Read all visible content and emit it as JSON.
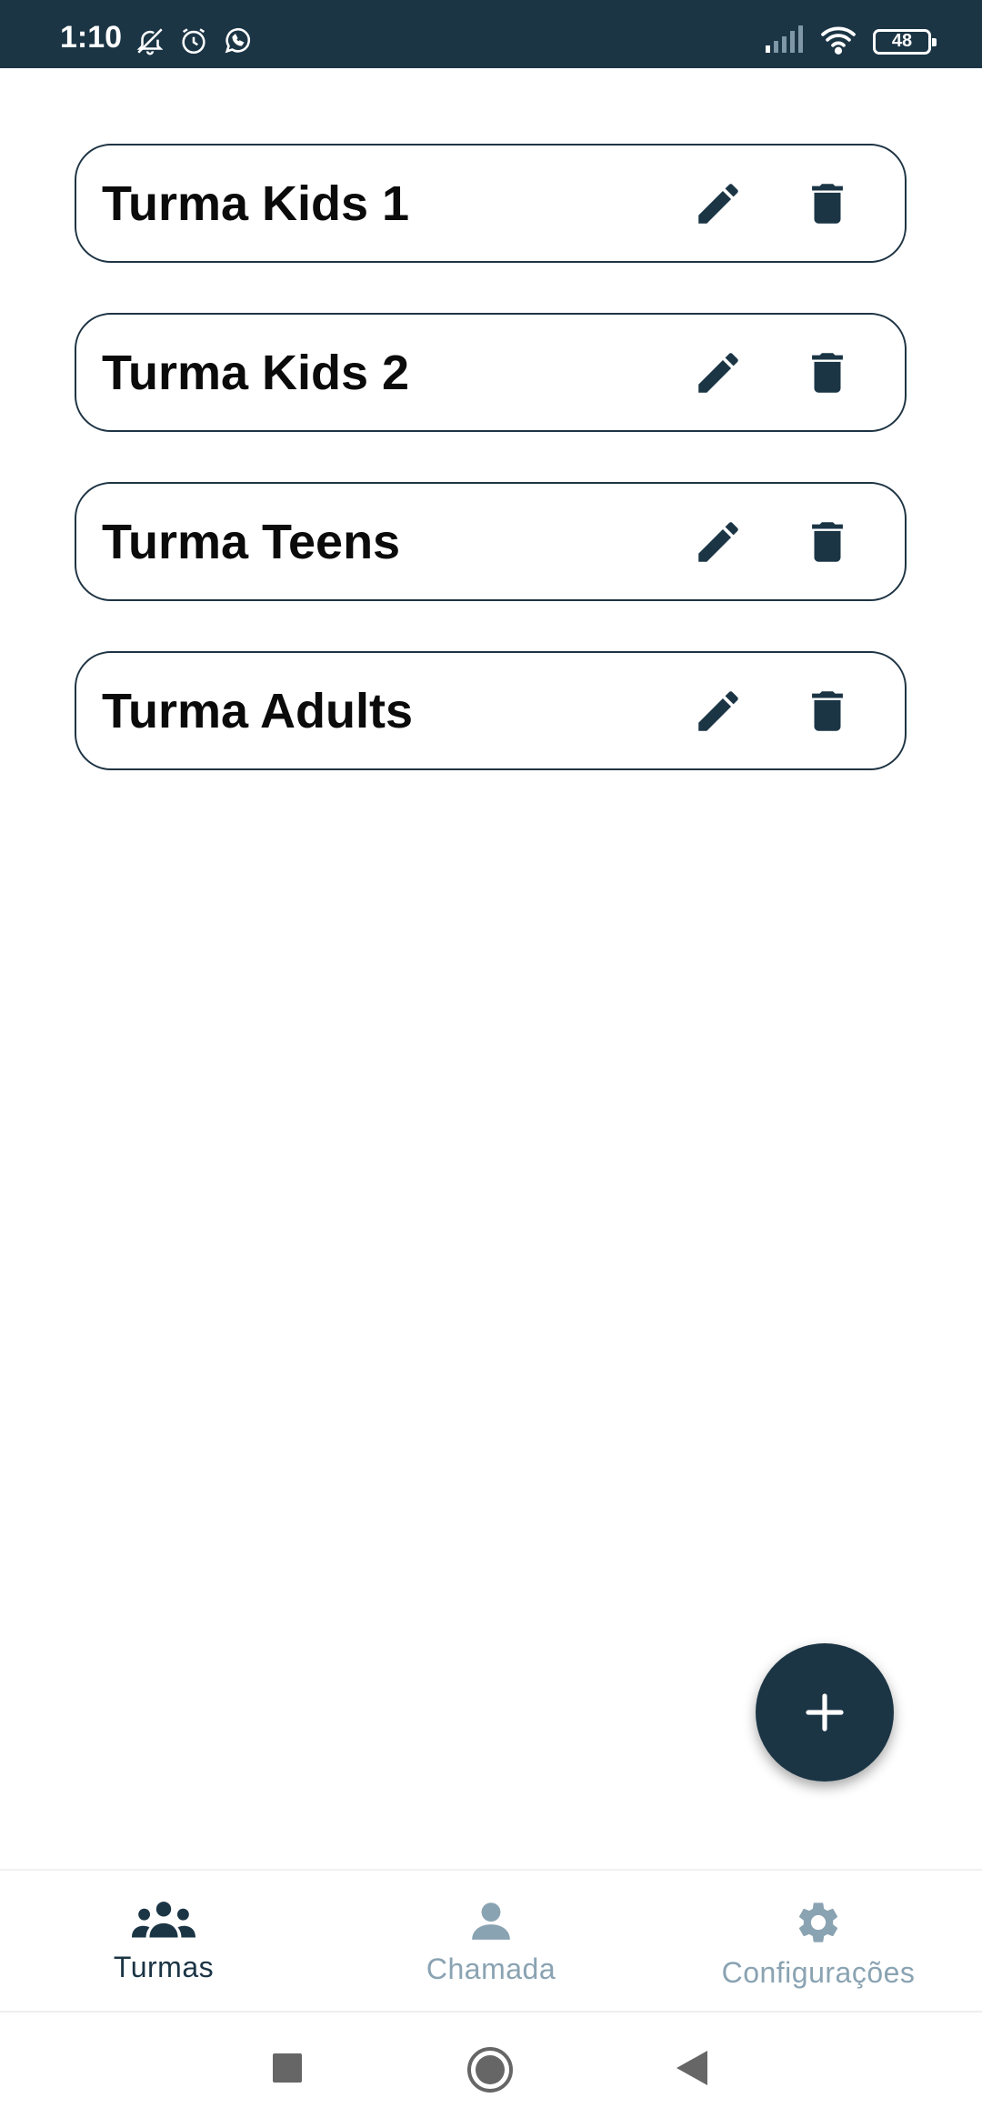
{
  "status_bar": {
    "time": "1:10",
    "battery": "48",
    "icons_left": [
      "bell-off-icon",
      "alarm-icon",
      "whatsapp-icon"
    ],
    "icons_right": [
      "signal-icon",
      "wifi-icon",
      "battery-icon"
    ]
  },
  "classes": [
    {
      "name": "Turma Kids 1"
    },
    {
      "name": "Turma Kids 2"
    },
    {
      "name": "Turma Teens"
    },
    {
      "name": "Turma Adults"
    }
  ],
  "fab": {
    "icon": "plus-icon"
  },
  "bottom_nav": {
    "items": [
      {
        "label": "Turmas",
        "icon": "group-icon",
        "active": true
      },
      {
        "label": "Chamada",
        "icon": "person-icon",
        "active": false
      },
      {
        "label": "Configurações",
        "icon": "gear-icon",
        "active": false
      }
    ]
  },
  "colors": {
    "primary": "#1b3545",
    "inactive": "#8aa3b2",
    "background": "#ffffff"
  }
}
